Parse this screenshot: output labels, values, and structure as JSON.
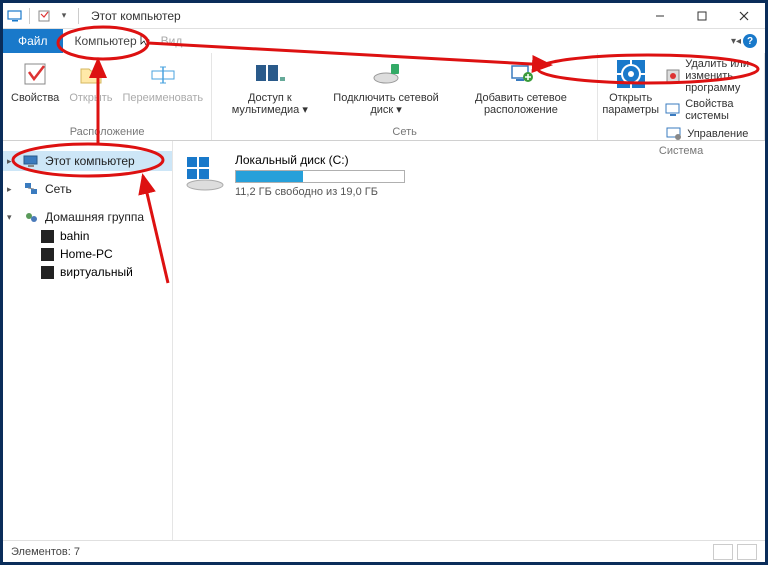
{
  "window": {
    "title": "Этот компьютер"
  },
  "menu": {
    "file": "Файл",
    "computer": "Компьютер",
    "view": "Вид"
  },
  "ribbon": {
    "location_group": "Расположение",
    "properties": "Свойства",
    "open": "Открыть",
    "rename": "Переименовать",
    "network_group": "Сеть",
    "media_access": "Доступ к мультимедиа",
    "connect_drive": "Подключить сетевой диск",
    "add_network": "Добавить сетевое расположение",
    "system_group": "Система",
    "open_params": "Открыть параметры",
    "uninstall": "Удалить или изменить программу",
    "sys_props": "Свойства системы",
    "manage": "Управление"
  },
  "nav": {
    "this_pc": "Этот компьютер",
    "network": "Сеть",
    "homegroup": "Домашняя группа",
    "items": [
      "bahin",
      "Home-PC",
      "виртуальный"
    ]
  },
  "content": {
    "drive_label": "Локальный диск (C:)",
    "drive_free": "11,2 ГБ свободно из 19,0 ГБ"
  },
  "status": {
    "count": "Элементов: 7"
  }
}
